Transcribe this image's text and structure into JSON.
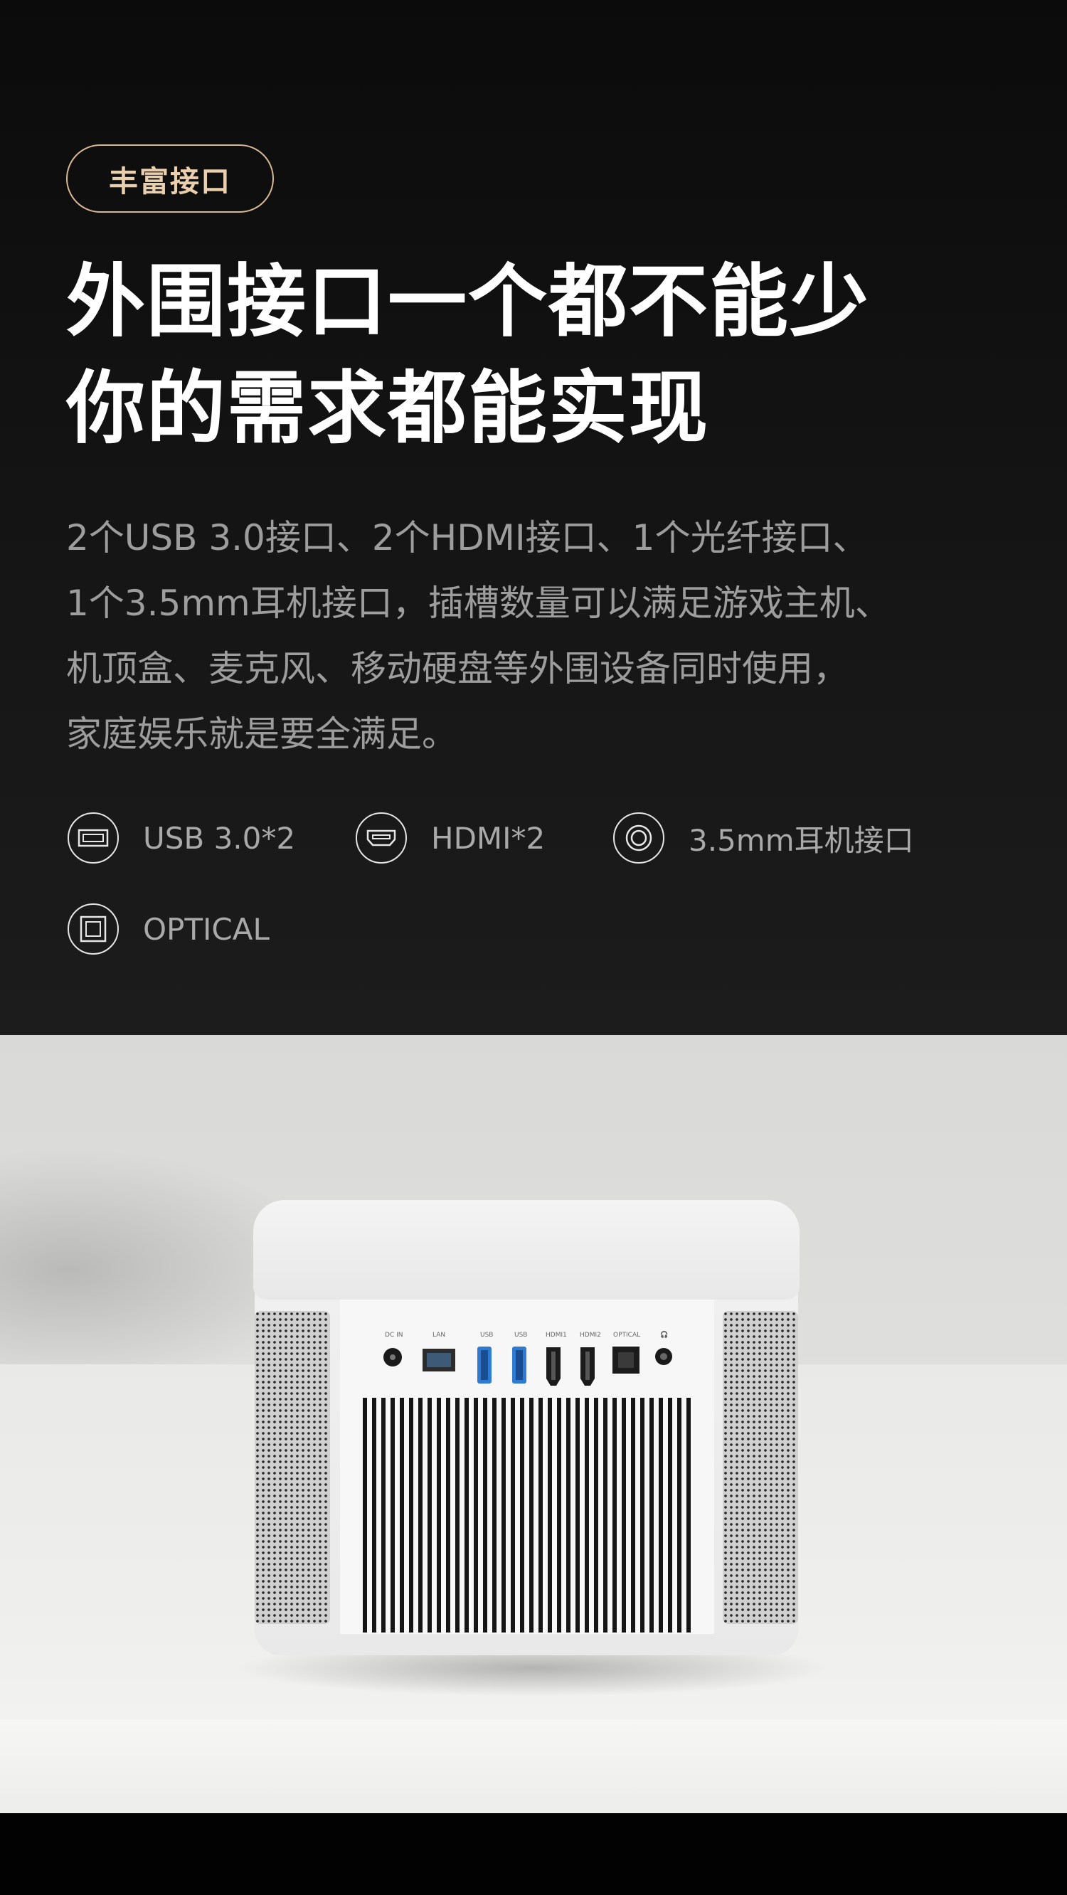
{
  "badge": "丰富接口",
  "headline": {
    "line1": "外围接口一个都不能少",
    "line2": "你的需求都能实现"
  },
  "description": {
    "line1": "2个USB 3.0接口、2个HDMI接口、1个光纤接口、",
    "line2": "1个3.5mm耳机接口，插槽数量可以满足游戏主机、",
    "line3": "机顶盒、麦克风、移动硬盘等外围设备同时使用，",
    "line4": "家庭娱乐就是要全满足。"
  },
  "features": [
    {
      "icon": "usb-port-icon",
      "label": "USB 3.0*2"
    },
    {
      "icon": "hdmi-port-icon",
      "label": "HDMI*2"
    },
    {
      "icon": "audio-jack-icon",
      "label": "3.5mm耳机接口"
    },
    {
      "icon": "optical-port-icon",
      "label": "OPTICAL"
    }
  ],
  "ports": {
    "dc_in": "DC IN",
    "lan": "LAN",
    "usb1": "USB",
    "usb2": "USB",
    "hdmi1": "HDMI1",
    "hdmi2": "HDMI2",
    "optical": "OPTICAL",
    "headphone": "🎧"
  }
}
